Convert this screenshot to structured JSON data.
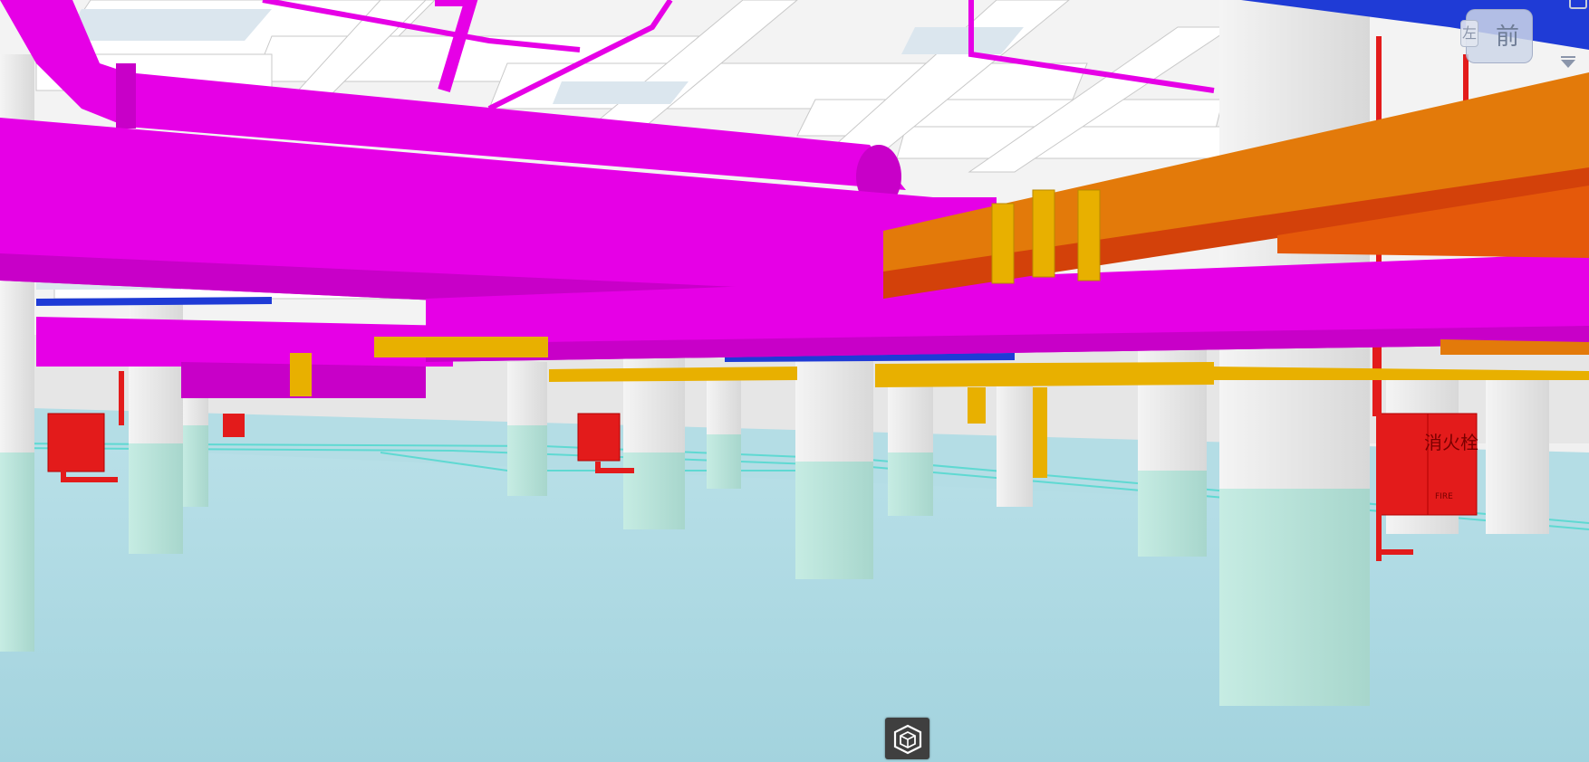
{
  "viewer": {
    "viewcube": {
      "front_label": "前",
      "side_label": "左"
    },
    "signs": {
      "fire_cabinet_right": "消火栓",
      "fire_cabinet_right_sub": "FIRE"
    },
    "colors": {
      "hvac_duct": "#e600e6",
      "cable_tray": "#e37a0a",
      "cable_tray_yellow": "#e8b000",
      "fire_pipe": "#e31b1b",
      "water_pipe_blue": "#1f3bd6",
      "floor": "#a8d6e0",
      "column": "#e8e8e8",
      "ceiling": "#f3f3f3",
      "toolbar": "#3f3f3f"
    },
    "toolbar": {
      "model_browser_icon": "model-cube-icon"
    }
  }
}
